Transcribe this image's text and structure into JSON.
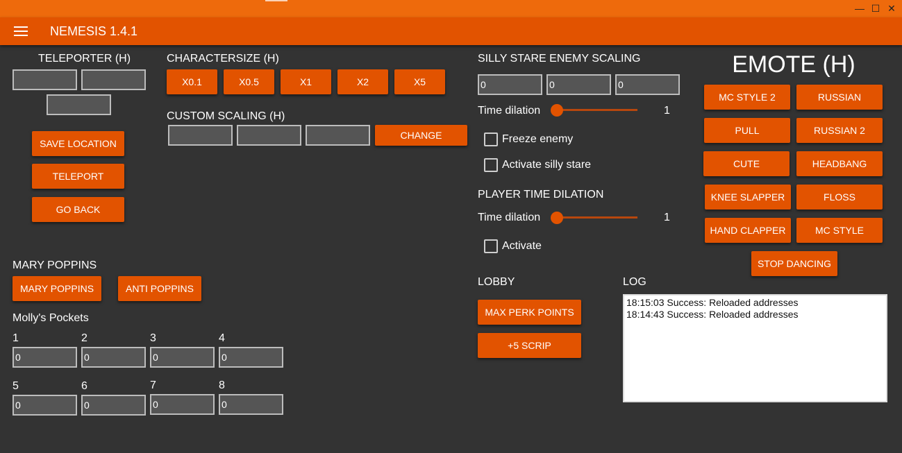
{
  "window": {
    "minimize_glyph": "—",
    "maximize_glyph": "☐",
    "close_glyph": "✕"
  },
  "appbar": {
    "title": "NEMESIS 1.4.1",
    "menu_icon": "hamburger-menu-icon"
  },
  "teleporter": {
    "title": "TELEPORTER (H)",
    "x_value": "",
    "y_value": "",
    "z_value": "",
    "save_label": "SAVE LOCATION",
    "teleport_label": "TELEPORT",
    "go_back_label": "GO BACK"
  },
  "charactersize": {
    "title": "CHARACTERSIZE (H)",
    "buttons": [
      "X0.1",
      "X0.5",
      "X1",
      "X2",
      "X5"
    ]
  },
  "custom_scaling": {
    "title": "CUSTOM SCALING (H)",
    "values": [
      "",
      "",
      ""
    ],
    "change_label": "CHANGE"
  },
  "silly_stare": {
    "title": "SILLY STARE ENEMY SCALING",
    "values": [
      "0",
      "0",
      "0"
    ],
    "time_dilation_label": "Time dilation",
    "time_dilation_value": "1",
    "freeze_label": "Freeze enemy",
    "activate_label": "Activate silly stare"
  },
  "player_time_dilation": {
    "title": "PLAYER TIME DILATION",
    "time_dilation_label": "Time dilation",
    "time_dilation_value": "1",
    "activate_label": "Activate"
  },
  "emote": {
    "title": "EMOTE (H)",
    "buttons": [
      "MC STYLE 2",
      "RUSSIAN",
      "PULL",
      "RUSSIAN 2",
      "CUTE",
      "HEADBANG",
      "KNEE SLAPPER",
      "FLOSS",
      "HAND CLAPPER",
      "MC STYLE"
    ],
    "stop_label": "STOP DANCING"
  },
  "mary_poppins": {
    "title": "MARY POPPINS",
    "mary_label": "MARY POPPINS",
    "anti_label": "ANTI POPPINS"
  },
  "pockets": {
    "title": "Molly's Pockets",
    "slots": [
      {
        "label": "1",
        "value": "0"
      },
      {
        "label": "2",
        "value": "0"
      },
      {
        "label": "3",
        "value": "0"
      },
      {
        "label": "4",
        "value": "0"
      },
      {
        "label": "5",
        "value": "0"
      },
      {
        "label": "6",
        "value": "0"
      },
      {
        "label": "7",
        "value": "0"
      },
      {
        "label": "8",
        "value": "0"
      }
    ]
  },
  "lobby": {
    "title": "LOBBY",
    "max_perk_label": "MAX PERK POINTS",
    "scrip_label": "+5 SCRIP"
  },
  "log": {
    "title": "LOG",
    "lines": [
      "18:15:03 Success: Reloaded addresses",
      "18:14:43 Success: Reloaded addresses"
    ]
  },
  "colors": {
    "accent": "#e25300",
    "titlebar": "#ee6a0c",
    "background": "#333333"
  }
}
